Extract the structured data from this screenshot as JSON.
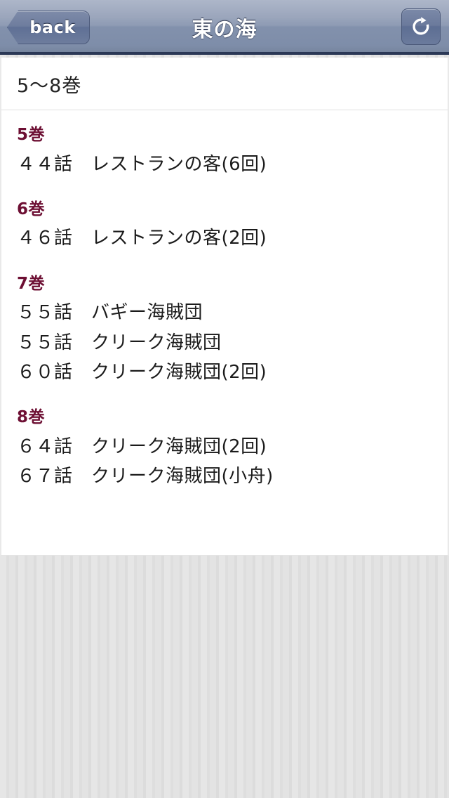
{
  "navbar": {
    "back_label": "back",
    "title": "東の海",
    "refresh_icon": "refresh-icon",
    "back_icon": "back-arrow-icon"
  },
  "content": {
    "subtitle": "5〜8巻",
    "volumes": [
      {
        "heading": "5巻",
        "episodes": [
          "４４話　レストランの客(6回)"
        ]
      },
      {
        "heading": "6巻",
        "episodes": [
          "４６話　レストランの客(2回)"
        ]
      },
      {
        "heading": "7巻",
        "episodes": [
          "５５話　バギー海賊団",
          "５５話　クリーク海賊団",
          "６０話　クリーク海賊団(2回)"
        ]
      },
      {
        "heading": "8巻",
        "episodes": [
          "６４話　クリーク海賊団(2回)",
          "６７話　クリーク海賊団(小舟)"
        ]
      }
    ]
  },
  "colors": {
    "navbar_top": "#adb6c9",
    "navbar_bottom": "#77869f",
    "navbar_border": "#2b3856",
    "heading": "#6d0f33",
    "text": "#1b1b1b",
    "page_background": "#e0e0e0",
    "card_background": "#ffffff"
  }
}
